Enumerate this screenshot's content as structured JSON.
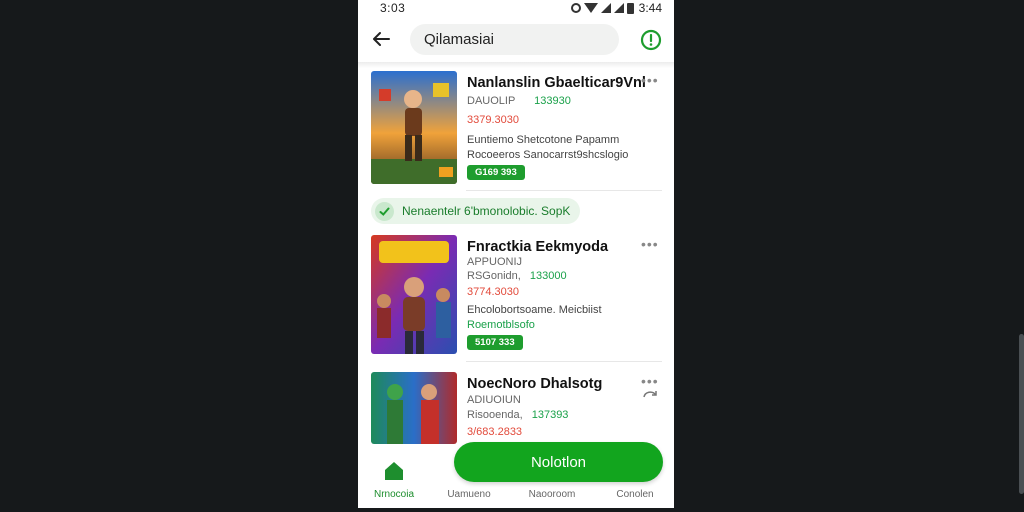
{
  "status_bar": {
    "time_left": "3:03",
    "time_right": "3:44"
  },
  "header": {
    "search_value": "Qilamasiai",
    "back_icon": "arrow-left-icon",
    "alert_icon": "alert-circle-icon"
  },
  "cards": [
    {
      "title": "Nanlanslin Gbaelticar9Vnl",
      "meta_a": "DAUOLIP",
      "meta_b": "133930",
      "price": "3379.3030",
      "desc_1": "Euntiemo Shetcotone Papamm",
      "desc_2": "Rocoeeros Sanocarrst9shcslogio",
      "desc_green": "",
      "pill": "G169 393",
      "more": "•••"
    },
    {
      "title": "Fnractkia Eekmyoda",
      "meta_a": "APPUONIJ",
      "meta_b_prefix": "RSGonidn,",
      "meta_b": "133000",
      "price": "3774.3030",
      "desc_1": "Ehcolobortsoame. Meicbiist",
      "desc_2": "",
      "desc_green": "Roemotblsofo",
      "pill": "5107 333",
      "more": "•••"
    },
    {
      "title": "NoecNoro Dhalsotg",
      "meta_a": "ADIUOIUN",
      "meta_b_prefix": "Risooenda,",
      "meta_b": "137393",
      "price": "3/683.2833",
      "desc_1": "",
      "desc_2": "",
      "desc_green": "",
      "pill": "",
      "more": "•••"
    }
  ],
  "badge": {
    "text": "Nenaentelr 6'bmonolobic. SopK"
  },
  "fab": {
    "label": "Nolotlon"
  },
  "bottom_nav": [
    {
      "label": "Nrnocoia",
      "icon": "home-icon"
    },
    {
      "label": "Uamueno",
      "icon": "list-icon"
    },
    {
      "label": "Naooroom",
      "icon": "grid-icon"
    },
    {
      "label": "Conolen",
      "icon": "profile-icon"
    }
  ],
  "colors": {
    "accent": "#12a51e",
    "price": "#e24a3b",
    "background": "#16191b"
  }
}
